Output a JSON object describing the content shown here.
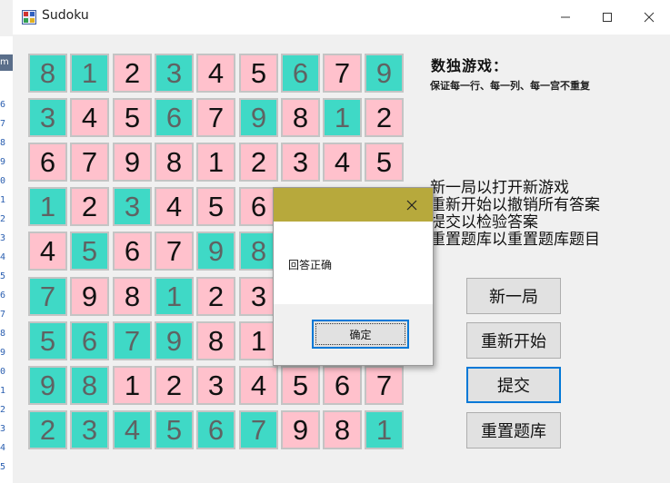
{
  "window": {
    "title": "Sudoku"
  },
  "background_strip": {
    "label": "m",
    "line_digits": [
      "6",
      "7",
      "8",
      "9",
      "0",
      "1",
      "2",
      "3",
      "4",
      "5",
      "6",
      "7",
      "8",
      "9",
      "0",
      "1",
      "2",
      "3",
      "4",
      "5"
    ]
  },
  "board": {
    "rows": [
      [
        {
          "v": "8",
          "c": "g"
        },
        {
          "v": "1",
          "c": "g"
        },
        {
          "v": "2",
          "c": "p"
        },
        {
          "v": "3",
          "c": "g"
        },
        {
          "v": "4",
          "c": "p"
        },
        {
          "v": "5",
          "c": "p"
        },
        {
          "v": "6",
          "c": "g"
        },
        {
          "v": "7",
          "c": "p"
        },
        {
          "v": "9",
          "c": "g"
        }
      ],
      [
        {
          "v": "3",
          "c": "g"
        },
        {
          "v": "4",
          "c": "p"
        },
        {
          "v": "5",
          "c": "p"
        },
        {
          "v": "6",
          "c": "g"
        },
        {
          "v": "7",
          "c": "p"
        },
        {
          "v": "9",
          "c": "g"
        },
        {
          "v": "8",
          "c": "p"
        },
        {
          "v": "1",
          "c": "g"
        },
        {
          "v": "2",
          "c": "p"
        }
      ],
      [
        {
          "v": "6",
          "c": "p"
        },
        {
          "v": "7",
          "c": "p"
        },
        {
          "v": "9",
          "c": "p"
        },
        {
          "v": "8",
          "c": "p"
        },
        {
          "v": "1",
          "c": "p"
        },
        {
          "v": "2",
          "c": "p"
        },
        {
          "v": "3",
          "c": "p"
        },
        {
          "v": "4",
          "c": "p"
        },
        {
          "v": "5",
          "c": "p"
        }
      ],
      [
        {
          "v": "1",
          "c": "g"
        },
        {
          "v": "2",
          "c": "p"
        },
        {
          "v": "3",
          "c": "g"
        },
        {
          "v": "4",
          "c": "p"
        },
        {
          "v": "5",
          "c": "p"
        },
        {
          "v": "6",
          "c": "p"
        },
        {
          "v": "",
          "c": "p"
        },
        {
          "v": "",
          "c": "p"
        },
        {
          "v": "",
          "c": "p"
        }
      ],
      [
        {
          "v": "4",
          "c": "p"
        },
        {
          "v": "5",
          "c": "g"
        },
        {
          "v": "6",
          "c": "p"
        },
        {
          "v": "7",
          "c": "p"
        },
        {
          "v": "9",
          "c": "g"
        },
        {
          "v": "8",
          "c": "g"
        },
        {
          "v": "",
          "c": "p"
        },
        {
          "v": "",
          "c": "p"
        },
        {
          "v": "",
          "c": "p"
        }
      ],
      [
        {
          "v": "7",
          "c": "g"
        },
        {
          "v": "9",
          "c": "p"
        },
        {
          "v": "8",
          "c": "p"
        },
        {
          "v": "1",
          "c": "g"
        },
        {
          "v": "2",
          "c": "p"
        },
        {
          "v": "3",
          "c": "p"
        },
        {
          "v": "",
          "c": "p"
        },
        {
          "v": "",
          "c": "p"
        },
        {
          "v": "",
          "c": "p"
        }
      ],
      [
        {
          "v": "5",
          "c": "g"
        },
        {
          "v": "6",
          "c": "g"
        },
        {
          "v": "7",
          "c": "g"
        },
        {
          "v": "9",
          "c": "g"
        },
        {
          "v": "8",
          "c": "p"
        },
        {
          "v": "1",
          "c": "p"
        },
        {
          "v": "",
          "c": "p"
        },
        {
          "v": "",
          "c": "p"
        },
        {
          "v": "",
          "c": "p"
        }
      ],
      [
        {
          "v": "9",
          "c": "g"
        },
        {
          "v": "8",
          "c": "g"
        },
        {
          "v": "1",
          "c": "p"
        },
        {
          "v": "2",
          "c": "p"
        },
        {
          "v": "3",
          "c": "p"
        },
        {
          "v": "4",
          "c": "p"
        },
        {
          "v": "5",
          "c": "p"
        },
        {
          "v": "6",
          "c": "p"
        },
        {
          "v": "7",
          "c": "p"
        }
      ],
      [
        {
          "v": "2",
          "c": "g"
        },
        {
          "v": "3",
          "c": "g"
        },
        {
          "v": "4",
          "c": "g"
        },
        {
          "v": "5",
          "c": "g"
        },
        {
          "v": "6",
          "c": "g"
        },
        {
          "v": "7",
          "c": "g"
        },
        {
          "v": "9",
          "c": "p"
        },
        {
          "v": "8",
          "c": "p"
        },
        {
          "v": "1",
          "c": "g"
        }
      ]
    ]
  },
  "info": {
    "heading": "数独游戏：",
    "subtitle": "保证每一行、每一列、每一宫不重复",
    "instructions": [
      "新一局以打开新游戏",
      "重新开始以撤销所有答案",
      "提交以检验答案",
      "重置题库以重置题库题目"
    ]
  },
  "buttons": {
    "new_game": "新一局",
    "restart": "重新开始",
    "submit": "提交",
    "reset_bank": "重置题库"
  },
  "dialog": {
    "message": "回答正确",
    "ok_label": "确定"
  },
  "colors": {
    "given_cell": "#3fd9c6",
    "answer_cell": "#ffc1cc",
    "dialog_title": "#b7a93c",
    "focus": "#0078d7"
  },
  "icons": {
    "app": "sudoku-app-icon",
    "minimize": "minimize-icon",
    "maximize": "maximize-icon",
    "close": "close-icon"
  }
}
